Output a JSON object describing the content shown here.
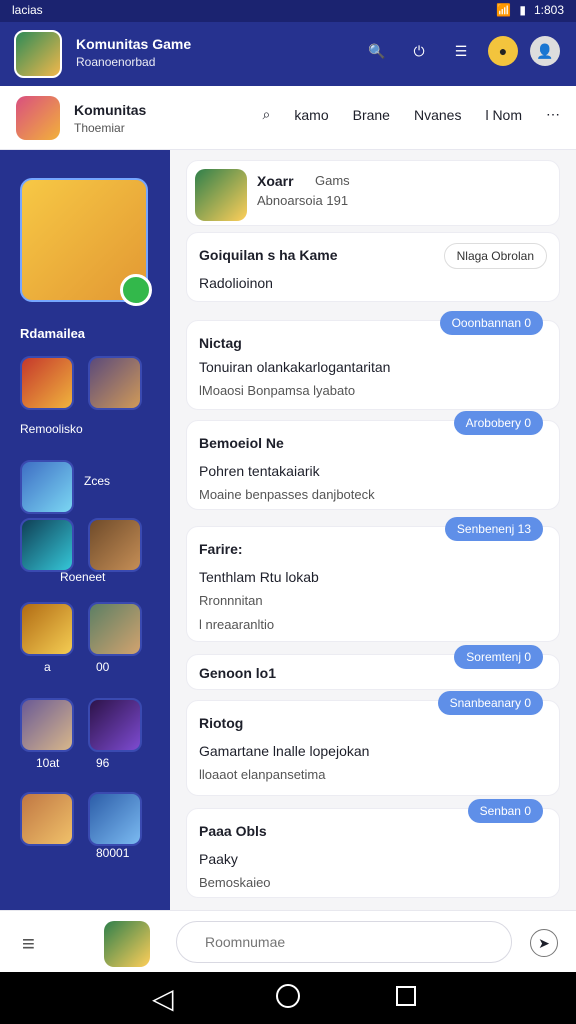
{
  "status": {
    "left": "lacias",
    "right_time": "1:803"
  },
  "appbar": {
    "title": "Komunitas Game",
    "subtitle": "Roanoenorbad"
  },
  "topnav": {
    "name": "Komunitas",
    "subtitle": "Thoemiar",
    "tabs": [
      "kamo",
      "Brane",
      "Nvanes",
      "l Nom"
    ]
  },
  "sidebar": {
    "section_title": "Rdamailea",
    "labels": [
      "Remoolisko",
      "Zces",
      "Roeneet",
      "a",
      "00",
      "10at",
      "96",
      "80001"
    ]
  },
  "cards": [
    {
      "head": "Xoarr",
      "sub1": "Gams",
      "sub2": "Abnoarsoia 191"
    },
    {
      "head": "Goiquilan s ha Kame",
      "line1": "Radolioinon",
      "bubble": "Nlaga Obrolan"
    },
    {
      "head": "Nictag",
      "line1": "Tonuiran olankakarlogantaritan",
      "line2": "lMoaosi Bonpamsa lyabato",
      "bubble": "Ooonbannan 0"
    },
    {
      "head": "Bemoeiol Ne",
      "line1": "Pohren tentakaiarik",
      "line2": "Moaine benpasses danjboteck",
      "bubble": "Arobobery 0"
    },
    {
      "head": "Farire:",
      "line1": "Tenthlam Rtu lokab",
      "line2": "Rronnnitan",
      "line3": "l nreaaranltio",
      "bubble": "Senbenenj 13"
    },
    {
      "head": "Genoon lo1",
      "bubble": "Soremtenj 0"
    },
    {
      "head": "Riotog",
      "line1": "Gamartane lnalle lopejokan",
      "line2": "lloaaot elanpansetima",
      "bubble": "Snanbeanary 0"
    },
    {
      "head": "Paaa Obls",
      "line1": "Paaky",
      "line2": "Bemoskaieo",
      "bubble": "Senban 0"
    }
  ],
  "bottom": {
    "placeholder": "Roomnumae"
  },
  "colors": {
    "primary": "#26328f",
    "accent": "#5f8fe8",
    "success": "#33b84b"
  }
}
